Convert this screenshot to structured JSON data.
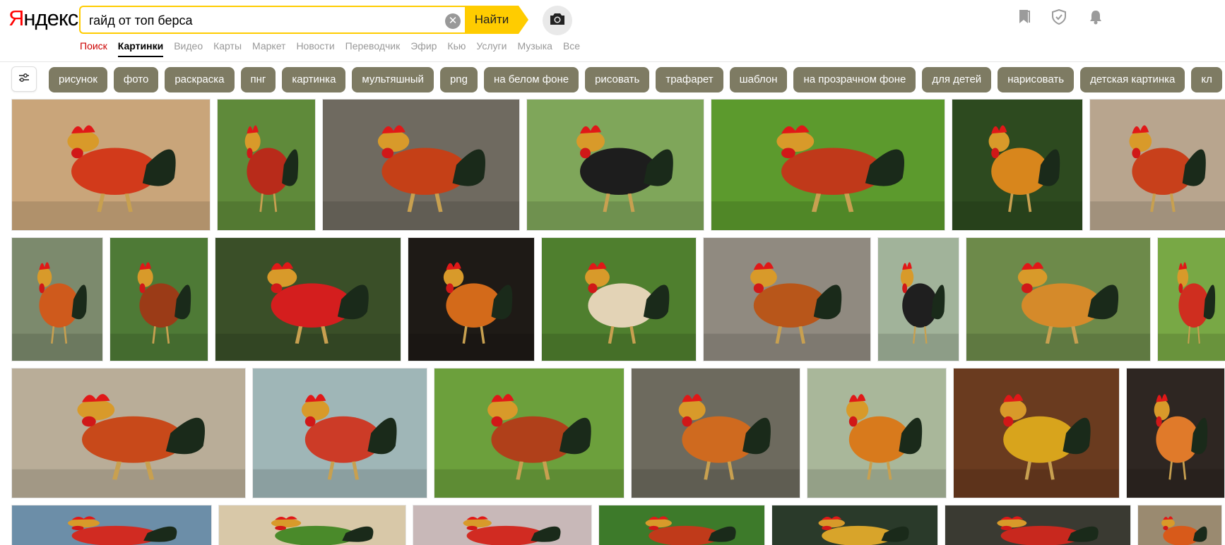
{
  "logo": {
    "first": "Я",
    "rest": "ндекс"
  },
  "search": {
    "value": "гайд от топ берса",
    "button_label": "Найти",
    "clear_symbol": "✕"
  },
  "nav": {
    "items": [
      {
        "label": "Поиск",
        "style": "red"
      },
      {
        "label": "Картинки",
        "style": "active"
      },
      {
        "label": "Видео",
        "style": ""
      },
      {
        "label": "Карты",
        "style": ""
      },
      {
        "label": "Маркет",
        "style": ""
      },
      {
        "label": "Новости",
        "style": ""
      },
      {
        "label": "Переводчик",
        "style": ""
      },
      {
        "label": "Эфир",
        "style": ""
      },
      {
        "label": "Кью",
        "style": ""
      },
      {
        "label": "Услуги",
        "style": ""
      },
      {
        "label": "Музыка",
        "style": ""
      },
      {
        "label": "Все",
        "style": ""
      }
    ]
  },
  "chips": [
    "рисунок",
    "фото",
    "раскраска",
    "пнг",
    "картинка",
    "мультяшный",
    "png",
    "на белом фоне",
    "рисовать",
    "трафарет",
    "шаблон",
    "на прозрачном фоне",
    "для детей",
    "нарисовать",
    "детская картинка",
    "кл"
  ],
  "colors": {
    "accent": "#ffcc00",
    "chip_bg": "#7e7b63",
    "nav_active": "#000000",
    "nav_red": "#cc0000"
  },
  "icons": {
    "camera": "camera-icon",
    "filter": "sliders-icon",
    "bookmarks": "bookmark-icon",
    "shield": "shield-icon",
    "notifications": "bell-icon"
  },
  "images": [
    {
      "bg": "#c9a57a",
      "accent": "#d23a1b"
    },
    {
      "bg": "#5f8a3a",
      "accent": "#b82b1a"
    },
    {
      "bg": "#6f6a60",
      "accent": "#c54017"
    },
    {
      "bg": "#7fa65a",
      "accent": "#1d1d1d"
    },
    {
      "bg": "#5c9a2d",
      "accent": "#c0391a"
    },
    {
      "bg": "#2d4a1f",
      "accent": "#d8861c"
    },
    {
      "bg": "#b8a58e",
      "accent": "#c8401b"
    },
    {
      "bg": "#7c8a6d",
      "accent": "#cf5a1c"
    },
    {
      "bg": "#4e7a36",
      "accent": "#9b3b17"
    },
    {
      "bg": "#3a4f28",
      "accent": "#d41e1e"
    },
    {
      "bg": "#1e1a16",
      "accent": "#d36a1a"
    },
    {
      "bg": "#4f7f2e",
      "accent": "#e3d3b6"
    },
    {
      "bg": "#908a80",
      "accent": "#b8561a"
    },
    {
      "bg": "#a1b39a",
      "accent": "#1f1f1f"
    },
    {
      "bg": "#6d8a4a",
      "accent": "#d58a2a"
    },
    {
      "bg": "#78a845",
      "accent": "#cf2e1f"
    },
    {
      "bg": "#b9ad98",
      "accent": "#c8491a"
    },
    {
      "bg": "#9fb6b7",
      "accent": "#cc3b27"
    },
    {
      "bg": "#6ca03c",
      "accent": "#b0401a"
    },
    {
      "bg": "#6d6a5e",
      "accent": "#cf6a1f"
    },
    {
      "bg": "#a9b79a",
      "accent": "#d87a1c"
    },
    {
      "bg": "#6a3b1f",
      "accent": "#d8a41c"
    },
    {
      "bg": "#2e2622",
      "accent": "#e07a2a"
    },
    {
      "bg": "#6c8ea8",
      "accent": "#d12b22"
    },
    {
      "bg": "#d8c8a8",
      "accent": "#4a8a2a"
    },
    {
      "bg": "#c8b8b8",
      "accent": "#d12b22"
    },
    {
      "bg": "#3d7a2a",
      "accent": "#c03a1a"
    },
    {
      "bg": "#2a3a2a",
      "accent": "#d8a42a"
    },
    {
      "bg": "#3a3a32",
      "accent": "#c8281e"
    },
    {
      "bg": "#9a8a70",
      "accent": "#d85a1a"
    }
  ]
}
